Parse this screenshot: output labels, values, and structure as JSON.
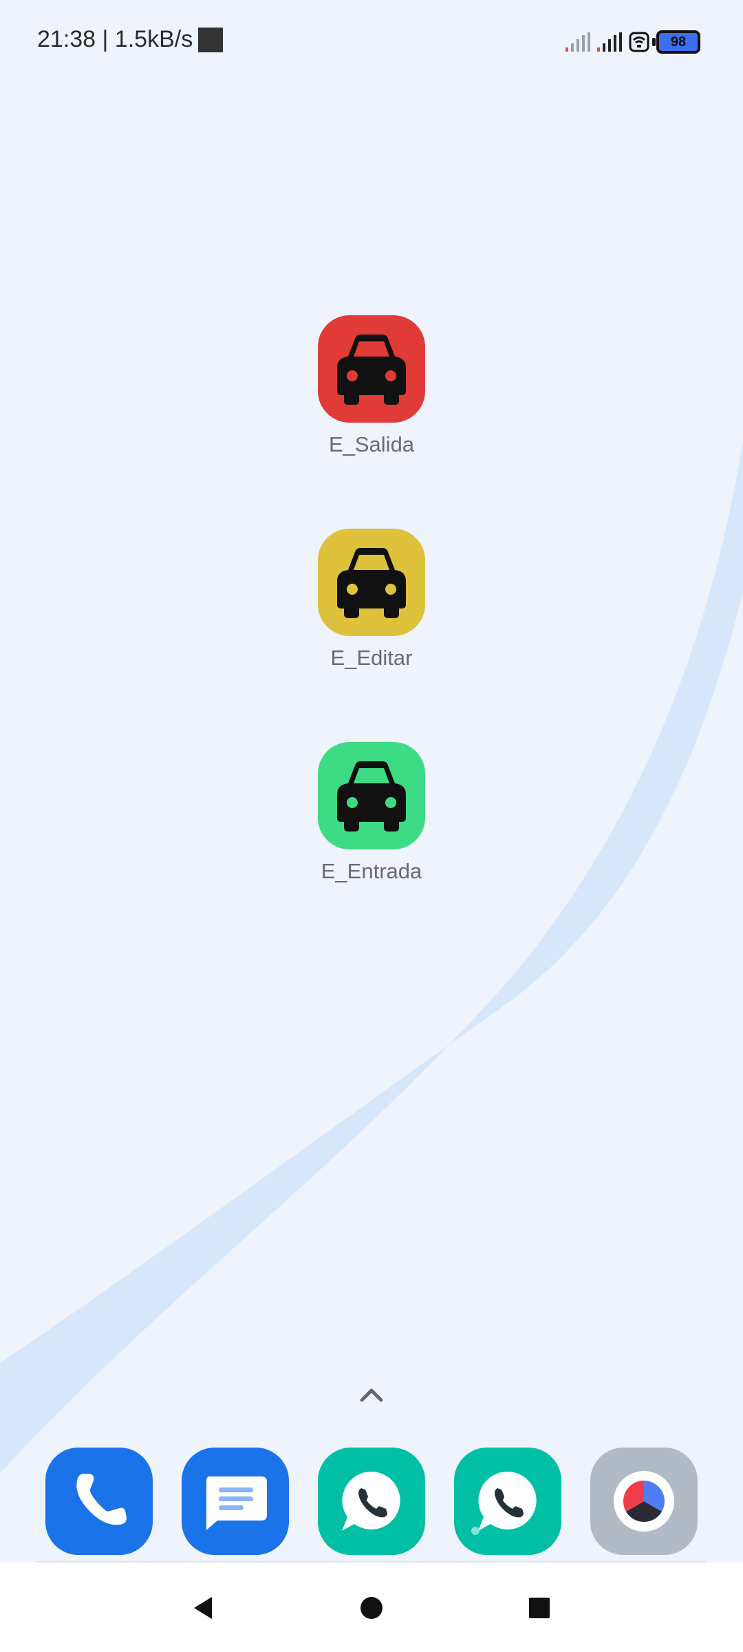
{
  "status_bar": {
    "time_speed": "21:38 | 1.5kB/s",
    "battery_level": "98"
  },
  "apps": [
    {
      "label": "E_Salida",
      "icon": "car-icon",
      "color": "#e03b37",
      "light_color": "#e03b37"
    },
    {
      "label": "E_Editar",
      "icon": "car-icon",
      "color": "#dec23c",
      "light_color": "#dec23c"
    },
    {
      "label": "E_Entrada",
      "icon": "car-icon",
      "color": "#3ddc84",
      "light_color": "#3ddc84"
    }
  ],
  "dock": [
    {
      "name": "phone",
      "icon": "phone-icon",
      "color": "#1a73e8"
    },
    {
      "name": "messages",
      "icon": "messages-icon",
      "color": "#1a73e8"
    },
    {
      "name": "whatsapp",
      "icon": "whatsapp-icon",
      "color": "#00bfa5"
    },
    {
      "name": "whatsapp-dual",
      "icon": "whatsapp-icon",
      "color": "#00bfa5"
    },
    {
      "name": "browser",
      "icon": "browser-icon",
      "color": "#b2bac6"
    }
  ],
  "navigation": [
    "back",
    "home",
    "recents"
  ]
}
